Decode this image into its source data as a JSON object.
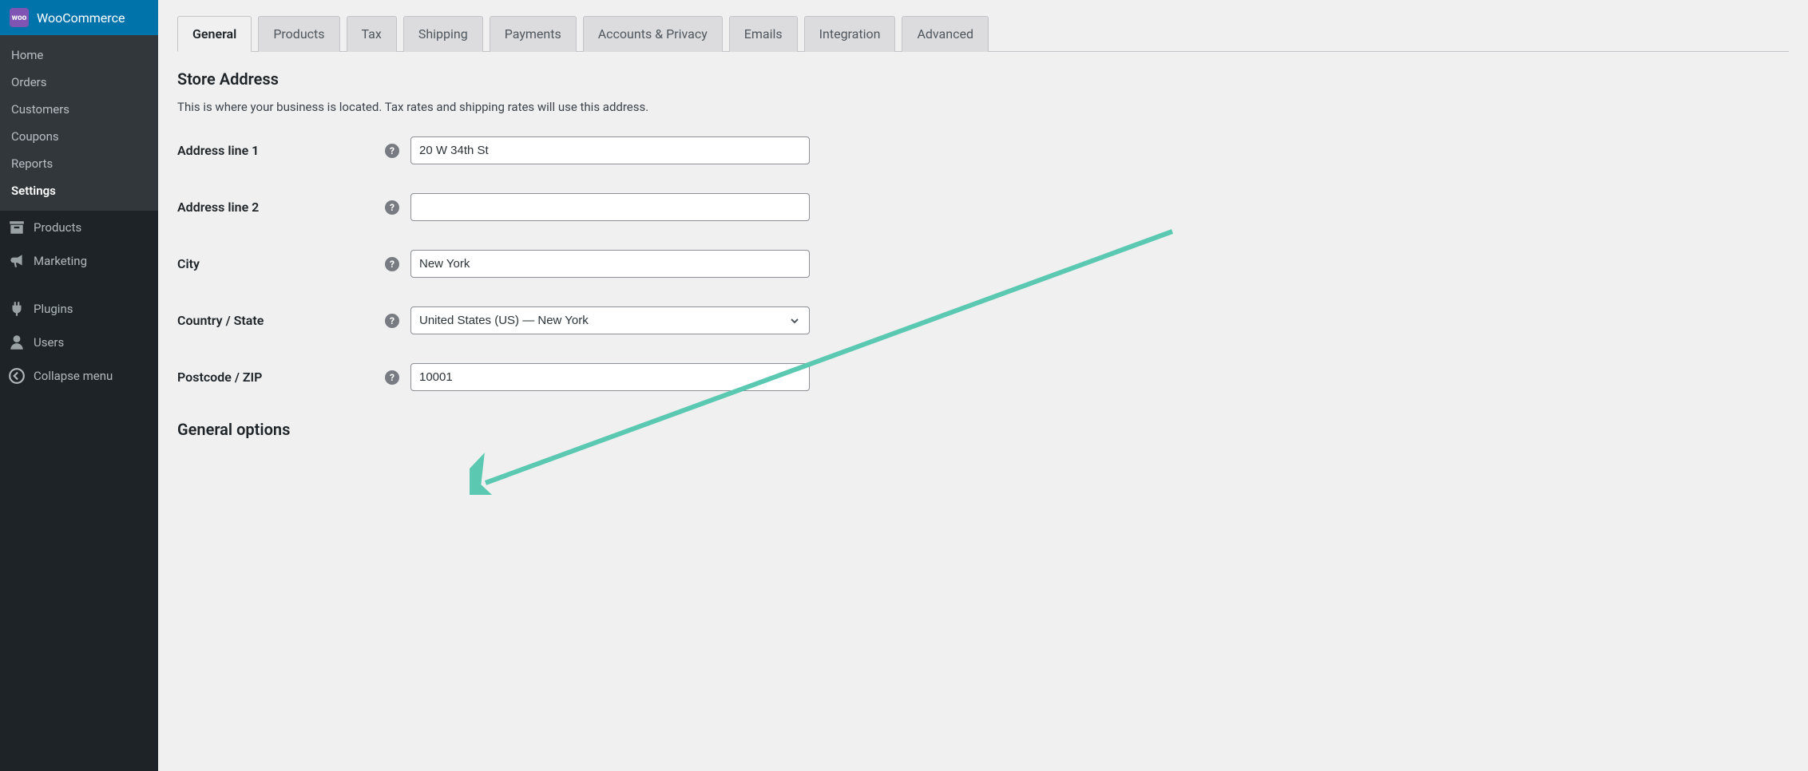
{
  "sidebar": {
    "brand": "WooCommerce",
    "brandIcon": "woo",
    "submenu": [
      {
        "label": "Home",
        "active": false
      },
      {
        "label": "Orders",
        "active": false
      },
      {
        "label": "Customers",
        "active": false
      },
      {
        "label": "Coupons",
        "active": false
      },
      {
        "label": "Reports",
        "active": false
      },
      {
        "label": "Settings",
        "active": true
      }
    ],
    "menu": [
      {
        "label": "Products",
        "icon": "archive"
      },
      {
        "label": "Marketing",
        "icon": "megaphone"
      }
    ],
    "menu2": [
      {
        "label": "Plugins",
        "icon": "plug"
      },
      {
        "label": "Users",
        "icon": "user"
      },
      {
        "label": "Collapse menu",
        "icon": "collapse"
      }
    ]
  },
  "tabs": [
    {
      "label": "General",
      "active": true
    },
    {
      "label": "Products",
      "active": false
    },
    {
      "label": "Tax",
      "active": false
    },
    {
      "label": "Shipping",
      "active": false
    },
    {
      "label": "Payments",
      "active": false
    },
    {
      "label": "Accounts & Privacy",
      "active": false
    },
    {
      "label": "Emails",
      "active": false
    },
    {
      "label": "Integration",
      "active": false
    },
    {
      "label": "Advanced",
      "active": false
    }
  ],
  "section1": {
    "heading": "Store Address",
    "desc": "This is where your business is located. Tax rates and shipping rates will use this address.",
    "fields": {
      "address1": {
        "label": "Address line 1",
        "value": "20 W 34th St"
      },
      "address2": {
        "label": "Address line 2",
        "value": ""
      },
      "city": {
        "label": "City",
        "value": "New York"
      },
      "country": {
        "label": "Country / State",
        "value": "United States (US) — New York"
      },
      "postcode": {
        "label": "Postcode / ZIP",
        "value": "10001"
      }
    }
  },
  "section2": {
    "heading": "General options"
  },
  "annotation": {
    "color": "#5bc9b1"
  }
}
